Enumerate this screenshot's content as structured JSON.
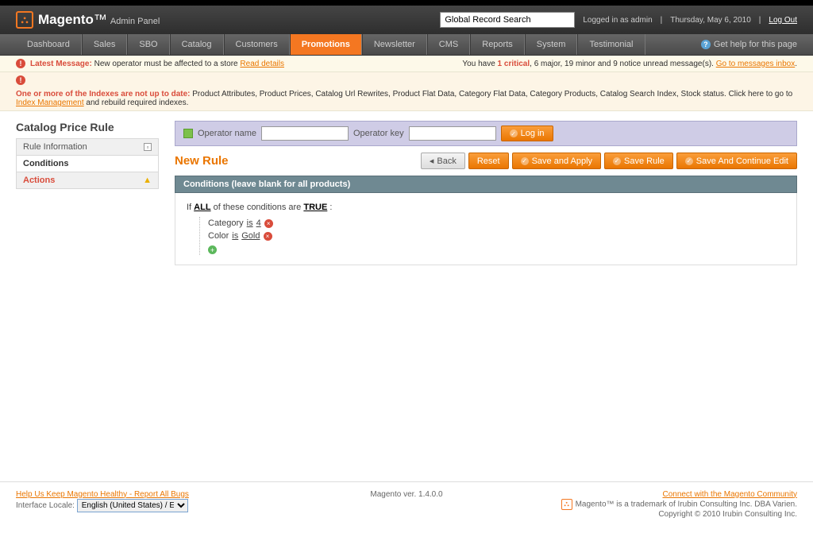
{
  "header": {
    "brand": "Magento",
    "panel": "Admin Panel",
    "search_placeholder": "Global Record Search",
    "logged_in": "Logged in as admin",
    "date": "Thursday, May 6, 2010",
    "logout": "Log Out"
  },
  "nav": {
    "items": [
      "Dashboard",
      "Sales",
      "SBO",
      "Catalog",
      "Customers",
      "Promotions",
      "Newsletter",
      "CMS",
      "Reports",
      "System",
      "Testimonial"
    ],
    "active": "Promotions",
    "help": "Get help for this page"
  },
  "messages": {
    "latest_label": "Latest Message:",
    "latest_text": "New operator must be affected to a store",
    "read_details": "Read details",
    "you_have": "You have",
    "critical": "1 critical",
    "rest": ", 6 major, 19 minor and 9 notice unread message(s).",
    "inbox_link": "Go to messages inbox",
    "index_label": "One or more of the Indexes are not up to date:",
    "index_text": "Product Attributes, Product Prices, Catalog Url Rewrites, Product Flat Data, Category Flat Data, Category Products, Catalog Search Index, Stock status. Click here to go to",
    "index_link": "Index Management",
    "index_tail": "and rebuild required indexes."
  },
  "sidebar": {
    "title": "Catalog Price Rule",
    "items": [
      {
        "label": "Rule Information",
        "type": "normal"
      },
      {
        "label": "Conditions",
        "type": "active"
      },
      {
        "label": "Actions",
        "type": "actions"
      }
    ]
  },
  "operator": {
    "name_label": "Operator name",
    "key_label": "Operator key",
    "login": "Log in"
  },
  "page": {
    "title": "New Rule",
    "buttons": {
      "back": "Back",
      "reset": "Reset",
      "save_apply": "Save and Apply",
      "save_rule": "Save Rule",
      "save_continue": "Save And Continue Edit"
    }
  },
  "panel": {
    "heading": "Conditions (leave blank for all products)",
    "root_pre": "If ",
    "root_all": "ALL",
    "root_mid": " of these conditions are ",
    "root_true": "TRUE",
    "root_end": " :",
    "conditions": [
      {
        "attr": "Category",
        "op": "is",
        "val": "4"
      },
      {
        "attr": "Color",
        "op": "is",
        "val": "Gold"
      }
    ]
  },
  "footer": {
    "bug_link": "Help Us Keep Magento Healthy - Report All Bugs",
    "locale_label": "Interface Locale:",
    "locale_value": "English (United States) / Englis",
    "version": "Magento ver. 1.4.0.0",
    "community": "Connect with the Magento Community",
    "trademark": "Magento™ is a trademark of Irubin Consulting Inc. DBA Varien.",
    "copyright": "Copyright © 2010 Irubin Consulting Inc."
  }
}
